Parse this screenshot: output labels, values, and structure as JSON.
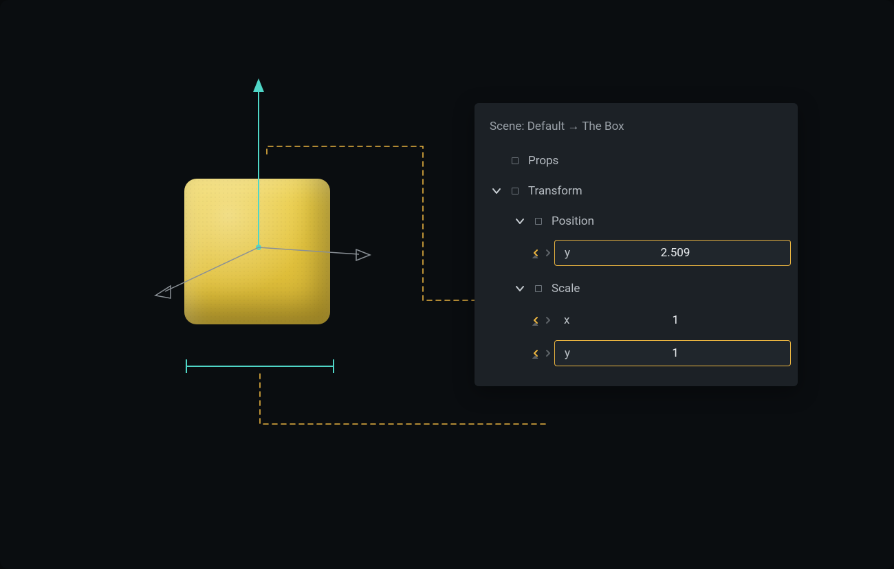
{
  "colors": {
    "accent_teal": "#4fd6c7",
    "accent_yellow": "#eab440",
    "panel_bg": "#1c2126",
    "canvas_bg": "#0a0d10",
    "text_muted": "#9aa1a8"
  },
  "breadcrumb": {
    "scene_prefix": "Scene:",
    "scene_name": "Default",
    "arrow": "→",
    "object_name": "The Box"
  },
  "inspector": {
    "props_label": "Props",
    "transform": {
      "label": "Transform",
      "position": {
        "label": "Position",
        "y": {
          "axis": "y",
          "value": "2.509",
          "highlighted": true
        }
      },
      "scale": {
        "label": "Scale",
        "x": {
          "axis": "x",
          "value": "1",
          "highlighted": false
        },
        "y": {
          "axis": "y",
          "value": "1",
          "highlighted": true
        }
      }
    }
  }
}
